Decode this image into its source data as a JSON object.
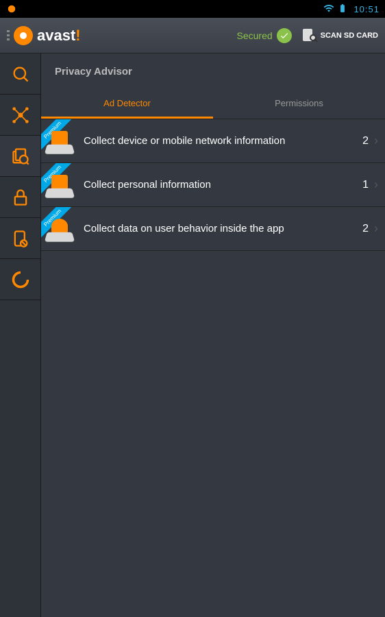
{
  "statusbar": {
    "time": "10:51"
  },
  "topbar": {
    "logo_text": "avast",
    "logo_excl": "!",
    "secured_label": "Secured",
    "scan_label": "SCAN SD CARD"
  },
  "page": {
    "title": "Privacy Advisor"
  },
  "tabs": [
    {
      "label": "Ad Detector",
      "active": true
    },
    {
      "label": "Permissions",
      "active": false
    }
  ],
  "rows": [
    {
      "badge": "Premium",
      "label": "Collect device or mobile network information",
      "count": "2"
    },
    {
      "badge": "Premium",
      "label": "Collect personal information",
      "count": "1"
    },
    {
      "badge": "Premium",
      "label": "Collect data on user behavior inside the app",
      "count": "2"
    }
  ],
  "colors": {
    "accent": "#ff8800",
    "success": "#8bc34a",
    "ribbon": "#00a8e8"
  }
}
